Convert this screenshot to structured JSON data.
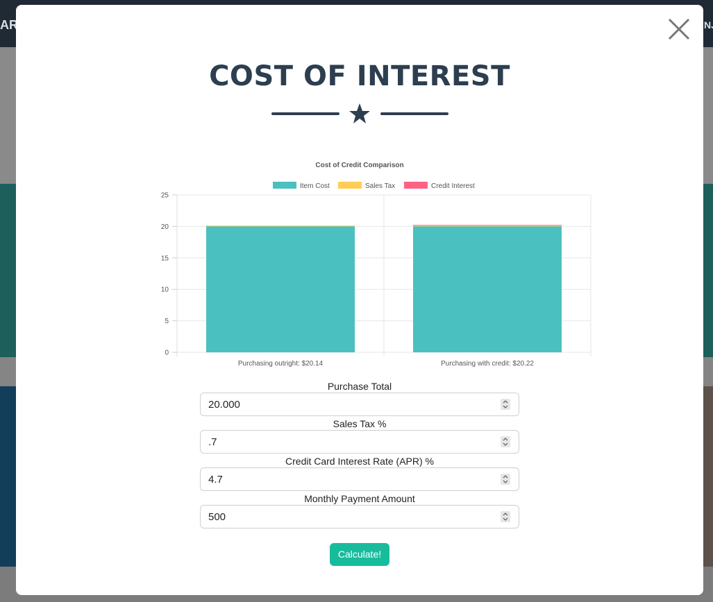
{
  "background": {
    "left_text": "ART",
    "right_text": "NJA"
  },
  "modal": {
    "title": "COST OF INTEREST",
    "close_icon": "close-icon",
    "divider_icon": "star-icon",
    "colors": {
      "title": "#2c3e50",
      "button": "#18bc9c",
      "item_cost": "#4bc0c0",
      "sales_tax": "#ffcd56",
      "credit_interest": "#ff6384"
    }
  },
  "chart_data": {
    "type": "bar",
    "stacked": true,
    "title": "Cost of Credit Comparison",
    "categories": [
      "Purchasing outright: $20.14",
      "Purchasing with credit: $20.22"
    ],
    "series": [
      {
        "name": "Item Cost",
        "values": [
          20.0,
          20.0
        ],
        "color": "#4bc0c0"
      },
      {
        "name": "Sales Tax",
        "values": [
          0.14,
          0.14
        ],
        "color": "#ffcd56"
      },
      {
        "name": "Credit Interest",
        "values": [
          0,
          0.08
        ],
        "color": "#ff6384"
      }
    ],
    "ylim": [
      0,
      25
    ],
    "yticks": [
      "0",
      "5",
      "10",
      "15",
      "20",
      "25"
    ],
    "grid": true,
    "legend": "top"
  },
  "form": {
    "purchase_total_label": "Purchase Total",
    "purchase_total_value": "20.000",
    "sales_tax_label": "Sales Tax %",
    "sales_tax_value": ".7",
    "apr_label": "Credit Card Interest Rate (APR) %",
    "apr_value": "4.7",
    "monthly_payment_label": "Monthly Payment Amount",
    "monthly_payment_value": "500",
    "calculate_label": "Calculate!"
  }
}
